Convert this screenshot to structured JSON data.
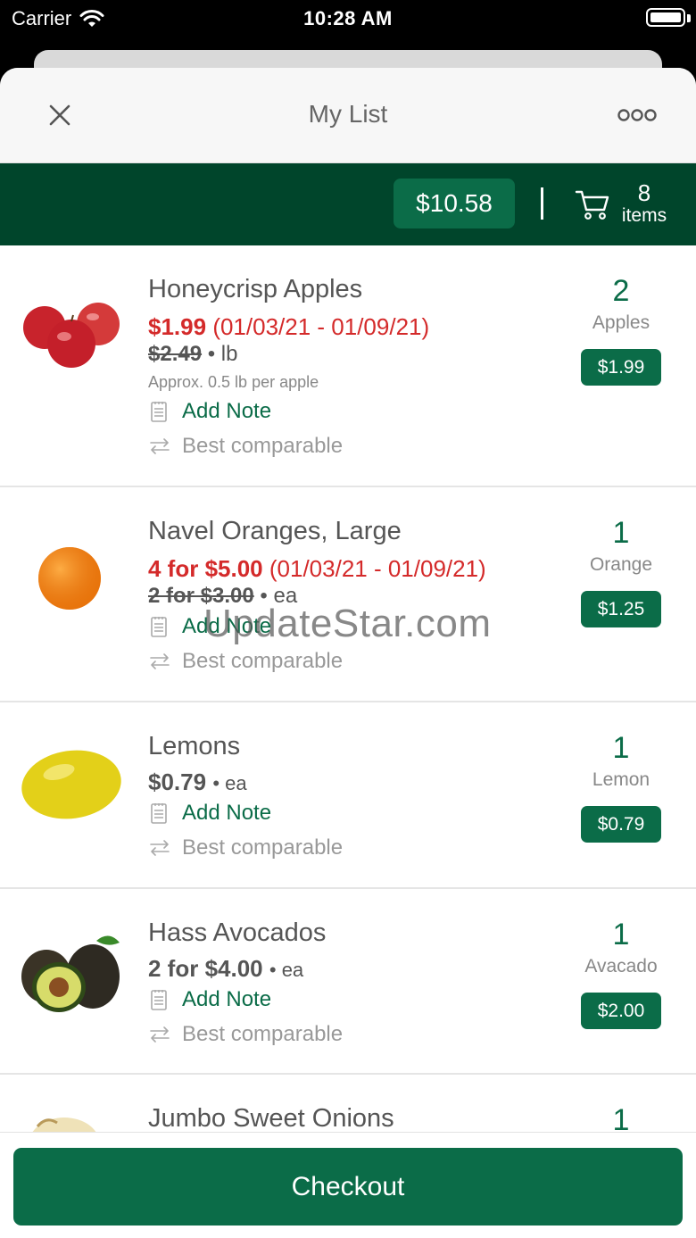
{
  "status_bar": {
    "carrier": "Carrier",
    "time": "10:28 AM"
  },
  "header": {
    "title": "My List"
  },
  "summary": {
    "total": "$10.58",
    "item_count": "8",
    "item_label": "items"
  },
  "items": [
    {
      "name": "Honeycrisp Apples",
      "sale_price": "$1.99",
      "sale_dates": "(01/03/21 - 01/09/21)",
      "old_price": "$2.49",
      "unit_suffix": "• lb",
      "approx": "Approx. 0.5 lb per apple",
      "note_label": "Add Note",
      "comparable_label": "Best comparable",
      "quantity": "2",
      "quantity_unit": "Apples",
      "line_total": "$1.99"
    },
    {
      "name": "Navel Oranges, Large",
      "sale_price": "4 for $5.00",
      "sale_dates": "(01/03/21 - 01/09/21)",
      "old_price": "2 for $3.00",
      "unit_suffix": "• ea",
      "note_label": "Add Note",
      "comparable_label": "Best comparable",
      "quantity": "1",
      "quantity_unit": "Orange",
      "line_total": "$1.25"
    },
    {
      "name": "Lemons",
      "price": "$0.79",
      "unit_suffix": "• ea",
      "note_label": "Add Note",
      "comparable_label": "Best comparable",
      "quantity": "1",
      "quantity_unit": "Lemon",
      "line_total": "$0.79"
    },
    {
      "name": "Hass Avocados",
      "price": "2 for $4.00",
      "unit_suffix": "• ea",
      "note_label": "Add Note",
      "comparable_label": "Best comparable",
      "quantity": "1",
      "quantity_unit": "Avacado",
      "line_total": "$2.00"
    },
    {
      "name": "Jumbo Sweet Onions",
      "quantity": "1"
    }
  ],
  "watermark": "UpdateStar.com",
  "checkout": {
    "label": "Checkout"
  },
  "colors": {
    "brand_dark": "#00452b",
    "brand": "#0b6c48",
    "sale_red": "#d42a2a"
  }
}
